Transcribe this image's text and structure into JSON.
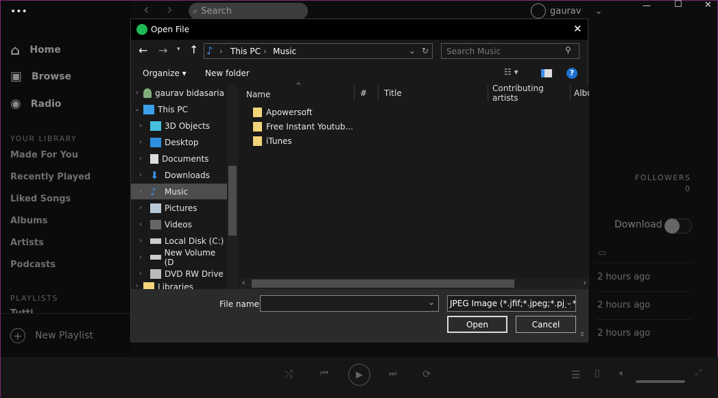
{
  "app": {
    "menu_dots": "•••",
    "back": "‹",
    "forward": "›",
    "search_placeholder": "Search",
    "user": "gaurav",
    "minimize": "—",
    "maximize": "☐",
    "close": "✕"
  },
  "sidebar": {
    "nav": [
      {
        "label": "Home",
        "icon": "home-icon"
      },
      {
        "label": "Browse",
        "icon": "browse-icon"
      },
      {
        "label": "Radio",
        "icon": "radio-icon"
      }
    ],
    "library_header": "YOUR LIBRARY",
    "library": [
      "Made For You",
      "Recently Played",
      "Liked Songs",
      "Albums",
      "Artists",
      "Podcasts"
    ],
    "playlists_header": "PLAYLISTS",
    "playlist_partial": "Tutti",
    "new_playlist": "New Playlist"
  },
  "right": {
    "followers_label": "FOLLOWERS",
    "followers_count": "0",
    "download_label": "Download",
    "download_on": false,
    "dates": [
      "2 hours ago",
      "2 hours ago",
      "2 hours ago"
    ]
  },
  "dialog": {
    "title": "Open File",
    "close": "✕",
    "breadcrumb": [
      "This PC",
      "Music"
    ],
    "search_placeholder": "Search Music",
    "organize": "Organize ▾",
    "new_folder": "New folder",
    "tree": [
      {
        "label": "gaurav bidasaria",
        "expanded": false
      },
      {
        "label": "This PC",
        "expanded": true
      },
      {
        "label": "3D Objects"
      },
      {
        "label": "Desktop"
      },
      {
        "label": "Documents"
      },
      {
        "label": "Downloads"
      },
      {
        "label": "Music",
        "selected": true
      },
      {
        "label": "Pictures"
      },
      {
        "label": "Videos"
      },
      {
        "label": "Local Disk (C:)"
      },
      {
        "label": "New Volume (D"
      },
      {
        "label": "DVD RW Drive"
      },
      {
        "label": "Libraries"
      }
    ],
    "columns": [
      "Name",
      "#",
      "Title",
      "Contributing artists",
      "Album"
    ],
    "files": [
      "Apowersoft",
      "Free Instant Youtub...",
      "iTunes"
    ],
    "filename_label": "File name:",
    "filename_value": "",
    "filetype": "JPEG Image (*.jfif;*.jpeg;*.pjp;*.",
    "open": "Open",
    "cancel": "Cancel"
  },
  "colors": {
    "folder": "#f3d47a",
    "spotify": "#1db954",
    "help": "#1e6fd0"
  }
}
